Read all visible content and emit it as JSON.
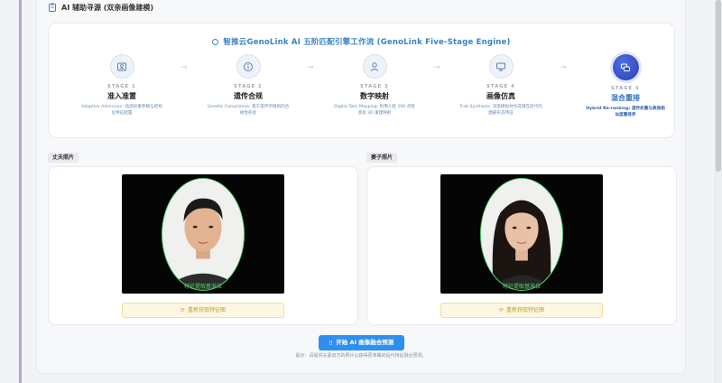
{
  "panel": {
    "title": "AI 辅助寻源 (双亲画像建模)"
  },
  "engine": {
    "title": "智推云GenoLink AI 五阶匹配引擎工作流 (GenoLink Five-Stage Engine)",
    "stages": [
      {
        "num": "STAGE 1",
        "name": "准入准置",
        "desc": "Adaptive Admission: 动态权重参数与结构化特征配置",
        "icon": "id-card-icon"
      },
      {
        "num": "STAGE 2",
        "name": "遗传合规",
        "desc": "Genetic Compliance: 基于遗传学规则的合规性校验",
        "icon": "info-circle-icon"
      },
      {
        "num": "STAGE 3",
        "name": "数字映射",
        "desc": "Digital Twin Mapping: 利用人脸 106 点检测及 3D 重建映射",
        "icon": "person-icon"
      },
      {
        "num": "STAGE 4",
        "name": "画像仿真",
        "desc": "Trait Synthesis: 深度模拟并合成潜在后代的面部形态特征",
        "icon": "monitor-icon"
      },
      {
        "num": "STAGE 5",
        "name": "混合重排",
        "desc": "Hybrid Re-ranking: 遗传权重与表观相似度重排序",
        "icon": "chat-bubbles-icon"
      }
    ]
  },
  "husband": {
    "label": "丈夫照片",
    "caption": "特征提取基准位",
    "refresh_label": "重新获取特征图"
  },
  "wife": {
    "label": "妻子照片",
    "caption": "特征提取基准位",
    "refresh_label": "重新获取特征图"
  },
  "actions": {
    "start_label": "开始 AI 画像融合预测",
    "hint": "提示：请提供夫妻双方的照片以获得更准确的后代特征融合预测。"
  },
  "colors": {
    "accent": "#2f8ff0",
    "title_blue": "#3b82c4",
    "face_frame": "#4ad06b",
    "warn_bg": "#fdf6e2"
  }
}
